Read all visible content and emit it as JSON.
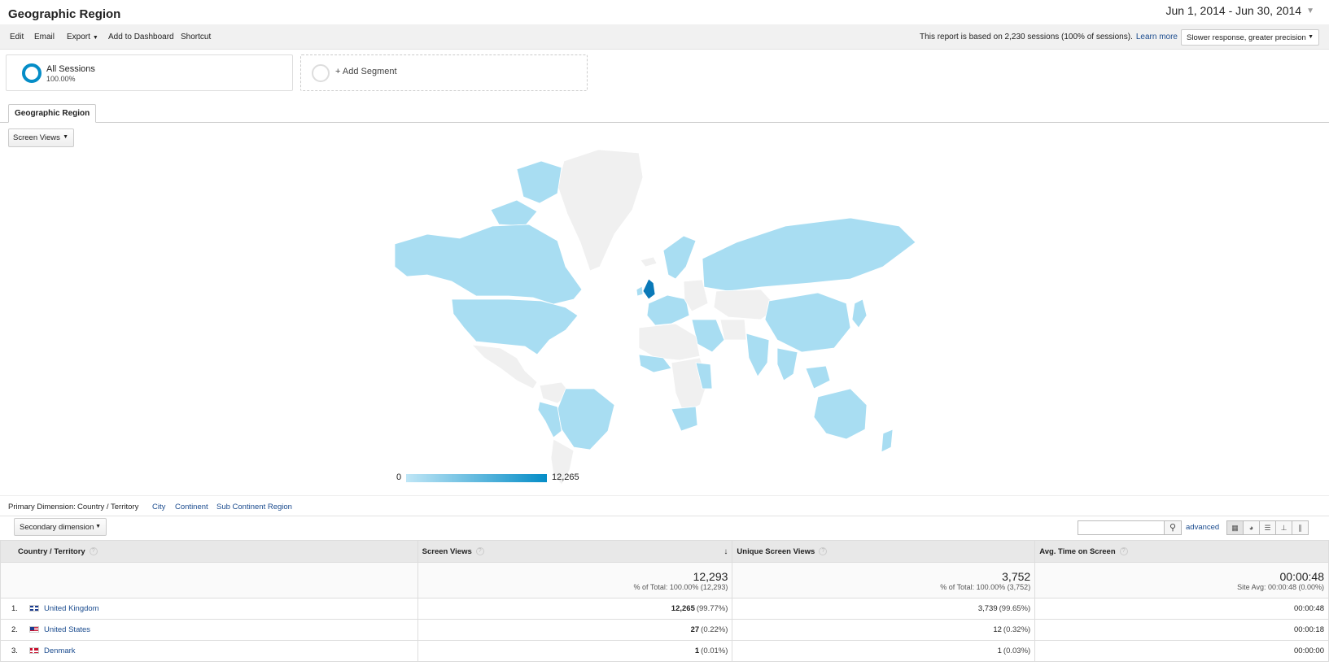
{
  "header": {
    "title": "Geographic Region",
    "date_range": "Jun 1, 2014 - Jun 30, 2014"
  },
  "toolbar": {
    "edit": "Edit",
    "email": "Email",
    "export": "Export",
    "add_to_dashboard": "Add to Dashboard",
    "shortcut": "Shortcut",
    "sessions_note": "This report is based on 2,230 sessions (100% of sessions).",
    "learn_more": "Learn more",
    "precision": "Slower response, greater precision"
  },
  "segments": {
    "all_sessions": "All Sessions",
    "all_sessions_pct": "100.00%",
    "add_segment": "+ Add Segment"
  },
  "tab": {
    "label": "Geographic Region"
  },
  "metric_selector": {
    "value": "Screen Views"
  },
  "map": {
    "legend_min": "0",
    "legend_max": "12,265",
    "colors": {
      "light": "#a8ddf2",
      "dark": "#0a79b8",
      "none": "#f0f0f0"
    }
  },
  "dimensions": {
    "label": "Primary Dimension:",
    "active": "Country / Territory",
    "options": [
      "City",
      "Continent",
      "Sub Continent Region"
    ]
  },
  "table_controls": {
    "secondary_dimension": "Secondary dimension",
    "search_placeholder": "",
    "advanced": "advanced"
  },
  "table": {
    "headers": [
      "Country / Territory",
      "Screen Views",
      "Unique Screen Views",
      "Avg. Time on Screen"
    ],
    "totals": {
      "screen_views": "12,293",
      "screen_views_sub": "% of Total: 100.00% (12,293)",
      "unique_views": "3,752",
      "unique_views_sub": "% of Total: 100.00% (3,752)",
      "avg_time": "00:00:48",
      "avg_time_sub": "Site Avg: 00:00:48 (0.00%)"
    },
    "rows": [
      {
        "rank": "1.",
        "country": "United Kingdom",
        "flag": "uk-flag-icon",
        "views": "12,265",
        "views_pct": "(99.77%)",
        "unique": "3,739",
        "unique_pct": "(99.65%)",
        "time": "00:00:48"
      },
      {
        "rank": "2.",
        "country": "United States",
        "flag": "us-flag-icon",
        "views": "27",
        "views_pct": "(0.22%)",
        "unique": "12",
        "unique_pct": "(0.32%)",
        "time": "00:00:18"
      },
      {
        "rank": "3.",
        "country": "Denmark",
        "flag": "dk-flag-icon",
        "views": "1",
        "views_pct": "(0.01%)",
        "unique": "1",
        "unique_pct": "(0.03%)",
        "time": "00:00:00"
      }
    ]
  }
}
